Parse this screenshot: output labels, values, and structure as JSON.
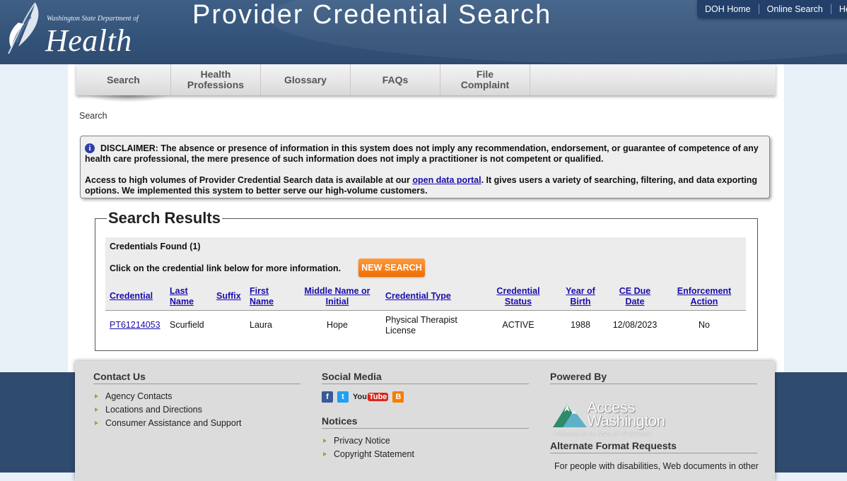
{
  "header": {
    "dept": "Washington State Department of",
    "agency": "Health",
    "title": "Provider Credential Search",
    "toplinks": [
      "DOH Home",
      "Online Search",
      "He"
    ]
  },
  "nav": {
    "tabs": [
      "Search",
      "Health\nProfessions",
      "Glossary",
      "FAQs",
      "File\nComplaint"
    ]
  },
  "breadcrumb": "Search",
  "disclaimer": {
    "text1": "DISCLAIMER: The absence or presence of information in this system does not imply any recommendation, endorsement, or guarantee of competence of any health care professional, the mere presence of such information does not imply a practitioner is not competent or qualified.",
    "text2_before": "Access to high volumes of Provider Credential Search data is available at our ",
    "link": "open data portal",
    "text2_after": ". It gives users a variety of searching, filtering, and data exporting options. We implemented this system to better serve our high-volume customers."
  },
  "results": {
    "legend": "Search Results",
    "found": "Credentials Found (1)",
    "instruction": "Click on the credential link below for more information.",
    "new_search": "NEW SEARCH",
    "columns": [
      "Credential",
      "Last\nName",
      "Suffix",
      "First\nName",
      "Middle Name or\nInitial",
      "Credential Type",
      "Credential\nStatus",
      "Year of\nBirth",
      "CE Due\nDate",
      "Enforcement\nAction"
    ],
    "rows": [
      {
        "credential": "PT61214053",
        "last_name": "Scurfield",
        "suffix": "",
        "first_name": "Laura",
        "middle_name": "Hope",
        "credential_type": "Physical Therapist\nLicense",
        "status": "ACTIVE",
        "year_of_birth": "1988",
        "ce_due_date": "12/08/2023",
        "enforcement_action": "No"
      }
    ]
  },
  "footer": {
    "contact_title": "Contact Us",
    "contact_links": [
      "Agency Contacts",
      "Locations and Directions",
      "Consumer Assistance and Support"
    ],
    "social_title": "Social Media",
    "social_icons": [
      "facebook-icon",
      "twitter-icon",
      "youtube-icon",
      "blogger-icon"
    ],
    "notices_title": "Notices",
    "notices_links": [
      "Privacy Notice",
      "Copyright Statement"
    ],
    "powered_title": "Powered By",
    "powered_logo": "Access Washington",
    "powered_tagline": "Welcome to the State of Washington",
    "alt_title": "Alternate Format Requests",
    "alt_text": "For people with disabilities, Web documents in other"
  },
  "colors": {
    "header_blue": "#345379",
    "link_blue": "#1a0dab",
    "new_search_orange": "#f27a10",
    "bullet_green": "#7cb534"
  }
}
